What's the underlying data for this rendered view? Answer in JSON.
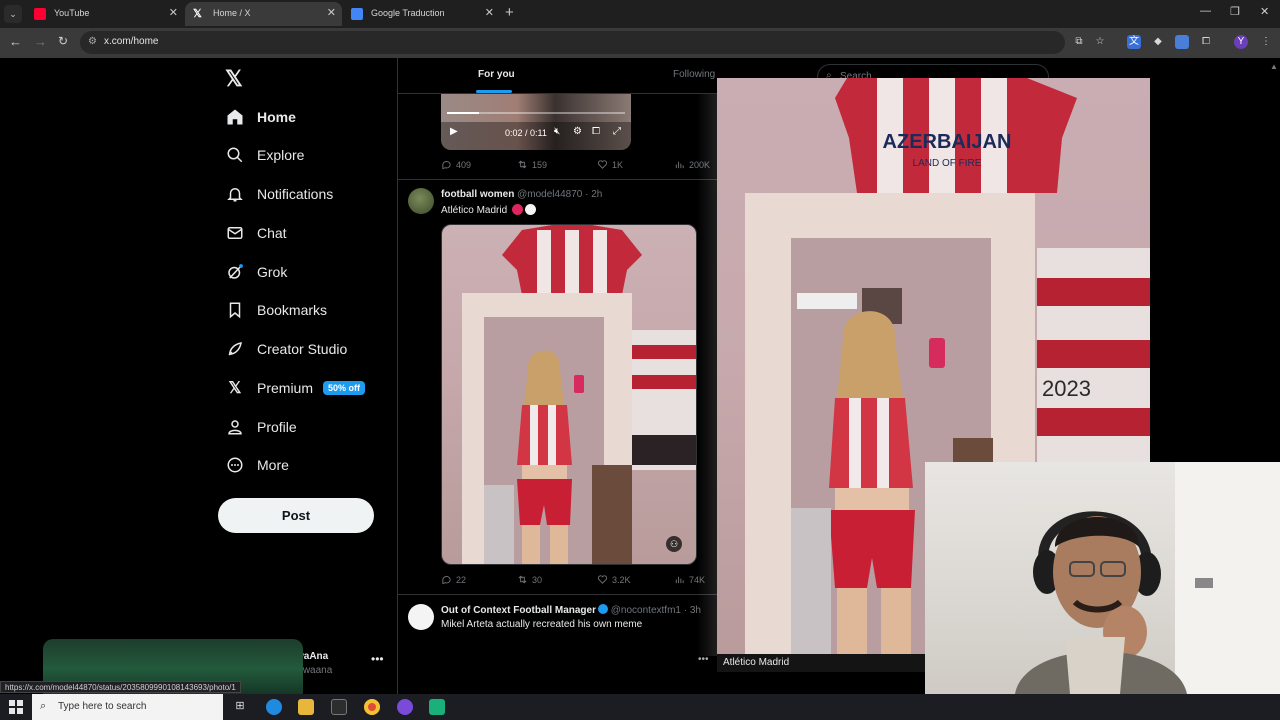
{
  "browser": {
    "tabs": [
      {
        "title": "YouTube",
        "active": false,
        "favicon_color": "#ff0033"
      },
      {
        "title": "Home / X",
        "active": true,
        "favicon_color": "#ffffff"
      },
      {
        "title": "Google Traduction",
        "active": false,
        "favicon_color": "#4285f4"
      }
    ],
    "url": "x.com/home",
    "status_url": "https://x.com/model44870/status/2035809990108143693/photo/1"
  },
  "nav": {
    "items": [
      {
        "label": "Home",
        "icon": "home-icon"
      },
      {
        "label": "Explore",
        "icon": "search-icon"
      },
      {
        "label": "Notifications",
        "icon": "bell-icon"
      },
      {
        "label": "Chat",
        "icon": "mail-icon"
      },
      {
        "label": "Grok",
        "icon": "grok-icon"
      },
      {
        "label": "Bookmarks",
        "icon": "bookmark-icon"
      },
      {
        "label": "Creator Studio",
        "icon": "rocket-icon"
      },
      {
        "label": "Premium",
        "icon": "x-logo-icon",
        "badge": "50% off"
      },
      {
        "label": "Profile",
        "icon": "person-icon"
      },
      {
        "label": "More",
        "icon": "more-circle-icon"
      }
    ],
    "post_label": "Post",
    "account": {
      "name": "DirtyhowaAna",
      "handle": "@Dirtyhowaana"
    }
  },
  "timeline": {
    "tabs": {
      "for_you": "For you",
      "following": "Following"
    },
    "video": {
      "time": "0:02 / 0:11",
      "progress": 0.18
    },
    "video_stats": {
      "replies": "409",
      "reposts": "159",
      "likes": "1K",
      "views": "200K"
    },
    "tweet1": {
      "name": "football women",
      "handle": "@model44870",
      "age": "· 2h",
      "text": "Atlético Madrid",
      "stats": {
        "replies": "22",
        "reposts": "30",
        "likes": "3.2K",
        "views": "74K"
      }
    },
    "tweet2": {
      "name": "Out of Context Football Manager",
      "handle": "@nocontextfm1",
      "age": "· 3h",
      "text": "Mikel Arteta actually recreated his own meme"
    }
  },
  "right": {
    "search_placeholder": "Search"
  },
  "preview": {
    "caption": "Atlético Madrid",
    "jersey_text": "AZERBAIJAN",
    "jersey_sub": "LAND OF FIRE",
    "flag_text": "2023"
  },
  "taskbar": {
    "search_placeholder": "Type here to search"
  },
  "colors": {
    "accent": "#1d9bf0",
    "atletico_red": "#e0245e"
  }
}
